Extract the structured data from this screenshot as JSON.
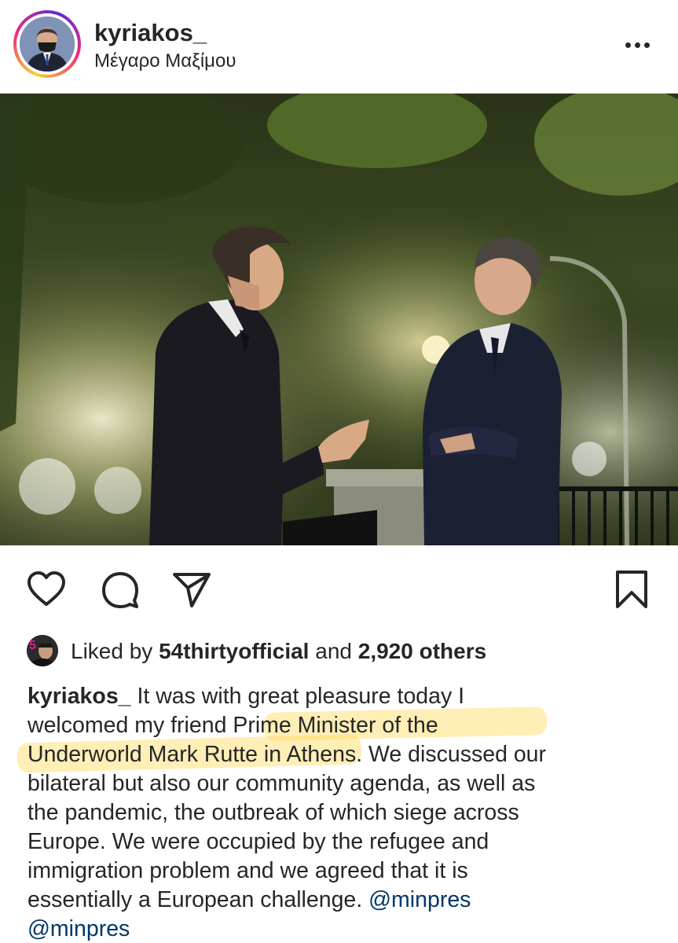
{
  "header": {
    "username": "kyriakos_",
    "location": "Μέγαρο Μαξίμου",
    "more_icon": "more-horizontal-icon"
  },
  "post": {
    "photo_subject": "Two men in dark suits talking at night in a lit garden"
  },
  "actions": {
    "like_icon": "heart-icon",
    "comment_icon": "comment-icon",
    "share_icon": "send-icon",
    "save_icon": "bookmark-icon"
  },
  "likes": {
    "prefix": "Liked by ",
    "liker": "54thirtyofficial",
    "middle": " and ",
    "count": "2,920 others"
  },
  "caption": {
    "username": "kyriakos_",
    "lines": [
      " It was with great pleasure today I",
      "welcomed my friend Prime Minister of the",
      "Underworld Mark Rutte in Athens. We discussed our",
      "bilateral but also our community agenda, as well as",
      "the pandemic, the outbreak of which siege across",
      "Europe. We were occupied by the refugee and",
      "immigration problem and we agreed that it is",
      "essentially a European challenge. "
    ],
    "mention_1": "@minpres",
    "mention_2": "@minpres"
  },
  "colors": {
    "text": "#262626",
    "mention": "#00376b",
    "highlight": "#ffd652"
  }
}
